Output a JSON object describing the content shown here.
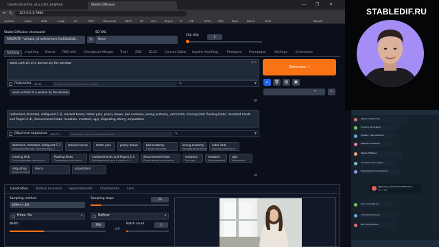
{
  "browser": {
    "tabs": [
      {
        "label": "talentcat/control_v1p_sd15_brightne"
      },
      {
        "label": "Stable Diffusion"
      }
    ],
    "window_controls": [
      "—",
      "❐",
      "✕"
    ],
    "url": "127.0.0.1:7860",
    "bookmarks": [
      "Android",
      "Боло",
      "WEB",
      "Граф",
      "AI",
      "КУРС",
      "Обучение",
      "ОБУЧ",
      "ПР",
      "LLM",
      "Звуки",
      "ТГ",
      "НФ",
      "MPW",
      "GPU",
      "Back",
      "Dall-E",
      "ЖКХ",
      "Прочее"
    ]
  },
  "app": {
    "checkpoint_label": "Stable Diffusion checkpoint",
    "checkpoint_value": "FAVORITE - \\photon_v1.safetensors [ec41bd2a8...",
    "vae_label": "SD VAE",
    "vae_value": "None",
    "clip_skip_label": "Clip skip",
    "clip_skip_value": "1",
    "tabs": [
      "txt2img",
      "img2img",
      "Extras",
      "PNG Info",
      "Checkpoint Merger",
      "Train",
      "SVD",
      "Z123",
      "Canvas Editor",
      "Inpaint Anything",
      "Photopea",
      "Promptgen",
      "Settings",
      "Extensions"
    ],
    "prompt": "waist portrait of a woman by the window",
    "prompt_counter": "0/75",
    "helper_label": "Подсказка",
    "helper_counter": "(8/75)",
    "helper_placeholder": "Введите новое ключевое слово",
    "prompt_chip": "waist portrait of a woman by the window",
    "negative_prompt": "(deformed, distorted, disfigured:1.3), stacked torsos, totem pole, poorly drawn, bad anatomy, wrong anatomy, extra limb, missing limb, floating limbs, (mutated hands and fingers:1.4), disconnected limbs, mutation, mutated, ugly, disgusting, blurry, amputation",
    "neg_helper_label": "Обратная подсказка",
    "neg_helper_counter": "(56/75)",
    "neg_placeholder": "Введите новое ключевое слово",
    "neg_chips": [
      {
        "text": "deformed, distorted, disfigured:1.3",
        "sub": "Деформированный, Искажённый:1.3"
      },
      {
        "text": "stacked torsos",
        "sub": ""
      },
      {
        "text": "totem pole",
        "sub": ""
      },
      {
        "text": "poorly drawn",
        "sub": ""
      },
      {
        "text": "bad anatomy",
        "sub": "Плохая анатомия"
      },
      {
        "text": "wrong anatomy",
        "sub": "Неправильная анатомия"
      },
      {
        "text": "extra limb",
        "sub": "Лишние конечности"
      },
      {
        "text": "missing limb",
        "sub": "Отсутствующие конечности"
      },
      {
        "text": "floating limbs",
        "sub": "Плавающие конечности"
      },
      {
        "text": "mutated hands and fingers:1.4",
        "sub": "Мутированные руки и пальцы:1.4"
      },
      {
        "text": "disconnected limbs",
        "sub": "Отключенные конечности"
      },
      {
        "text": "mutation",
        "sub": "Мутация"
      },
      {
        "text": "mutated",
        "sub": "Мутированный"
      },
      {
        "text": "ugly",
        "sub": "Уродливый"
      },
      {
        "text": "disgusting",
        "sub": "Отвратительный"
      },
      {
        "text": "blurry",
        "sub": ""
      },
      {
        "text": "amputation",
        "sub": ""
      }
    ],
    "generate_label": "Generate",
    "subtabs": [
      "Generation",
      "Textual Inversion",
      "Hypernetworks",
      "Checkpoints",
      "Lora"
    ],
    "sampling_method_label": "Sampling method",
    "sampling_method_value": "DPM++ 2M",
    "sampling_steps_label": "Sampling steps",
    "sampling_steps_value": "20",
    "sampling_steps_fraction": 0.13,
    "hires_label": "Hires. fix",
    "refiner_label": "Refiner",
    "width_label": "Width",
    "width_value": "768",
    "batch_count_label": "Batch count",
    "batch_count_value": "1",
    "off_label": "Off"
  },
  "webcam": {
    "brand": "STABLEDIF.RU"
  },
  "chat": {
    "messages": [
      "Админ Нейросети",
      "Ссылка на модели",
      "Привет, где скачать?",
      "Ещё раз спасибо!",
      "Stable Diffusion",
      "Сколько стоит курс?",
      "Подскажите пожалуйста",
      "Как установить?",
      "Спасибо большое",
      "Всё получилось!"
    ],
    "file_name": "light_lead_controlnet.safetensors",
    "file_size": "723.3 MB"
  },
  "colors": {
    "accent": "#f97316",
    "bg": "#0b0f19",
    "panel": "#1f2937",
    "chat_bg": "#17212b",
    "circle": "#a48df5"
  }
}
